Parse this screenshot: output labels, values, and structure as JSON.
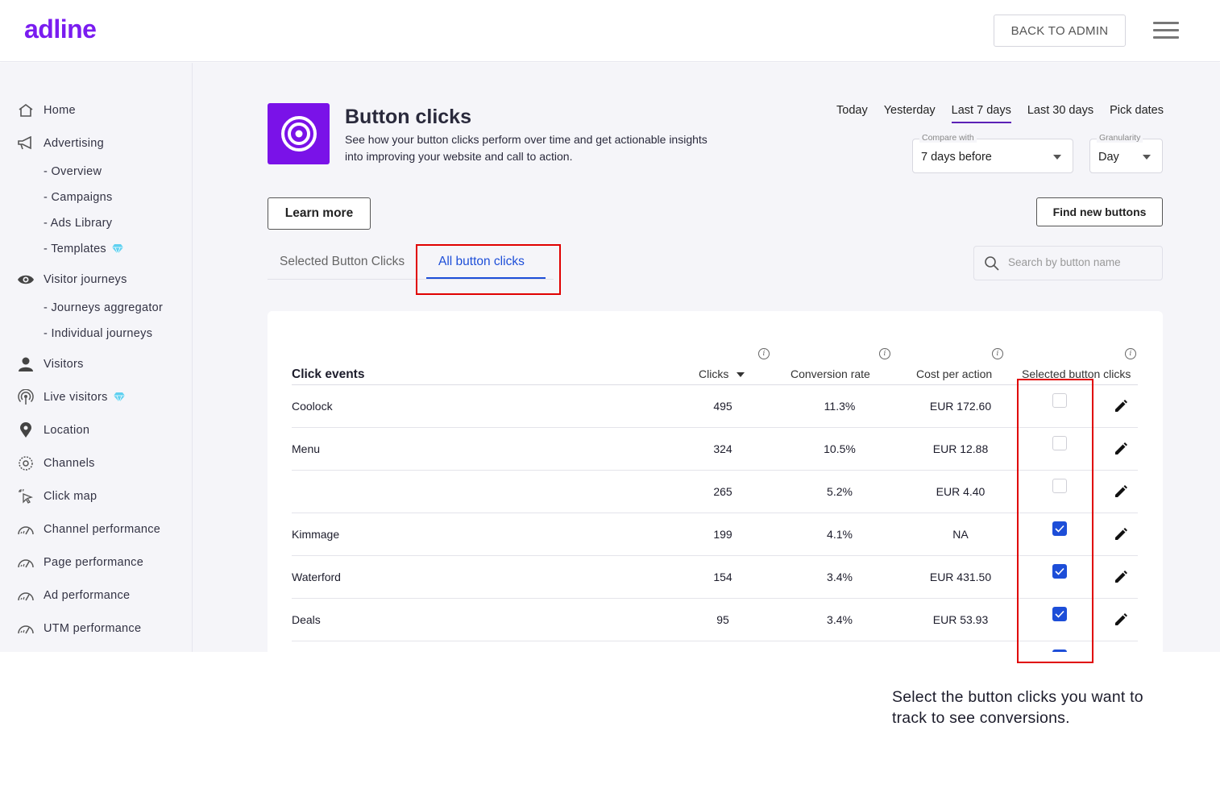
{
  "brand": {
    "logo": "adline",
    "accent": "#7a12e8"
  },
  "topbar": {
    "back_label": "BACK TO ADMIN"
  },
  "sidebar": {
    "items": [
      {
        "label": "Home",
        "icon": "home-icon"
      },
      {
        "label": "Advertising",
        "icon": "megaphone-icon"
      },
      {
        "label": "- Overview",
        "sub": true
      },
      {
        "label": "- Campaigns",
        "sub": true
      },
      {
        "label": "- Ads Library",
        "sub": true
      },
      {
        "label": "- Templates",
        "sub": true,
        "premium": true
      },
      {
        "label": "Visitor journeys",
        "icon": "eye-icon"
      },
      {
        "label": "- Journeys aggregator",
        "sub": true
      },
      {
        "label": "- Individual journeys",
        "sub": true
      },
      {
        "label": "Visitors",
        "icon": "person-icon"
      },
      {
        "label": "Live visitors",
        "icon": "broadcast-icon",
        "premium": true
      },
      {
        "label": "Location",
        "icon": "pin-icon"
      },
      {
        "label": "Channels",
        "icon": "channels-icon"
      },
      {
        "label": "Click map",
        "icon": "cursor-click-icon"
      },
      {
        "label": "Channel performance",
        "icon": "gauge-icon"
      },
      {
        "label": "Page performance",
        "icon": "gauge-icon"
      },
      {
        "label": "Ad performance",
        "icon": "gauge-icon"
      },
      {
        "label": "UTM performance",
        "icon": "gauge-icon"
      }
    ]
  },
  "header": {
    "title": "Button clicks",
    "description": "See how your button clicks perform over time and get actionable insights into improving your website and call to action."
  },
  "date_range": {
    "tabs": [
      "Today",
      "Yesterday",
      "Last 7 days",
      "Last 30 days",
      "Pick dates"
    ],
    "active": "Last 7 days"
  },
  "compare": {
    "label": "Compare with",
    "value": "7 days before"
  },
  "granularity": {
    "label": "Granularity",
    "value": "Day"
  },
  "actions": {
    "learn_more": "Learn more",
    "find_new": "Find new buttons"
  },
  "tabs": {
    "selected": "Selected Button Clicks",
    "all": "All button clicks"
  },
  "search": {
    "placeholder": "Search by button name"
  },
  "table": {
    "headers": {
      "name": "Click events",
      "clicks": "Clicks",
      "conversion": "Conversion rate",
      "cost": "Cost per action",
      "selected": "Selected button clicks"
    },
    "rows": [
      {
        "name": "Coolock",
        "clicks": "495",
        "conversion": "11.3%",
        "cost": "EUR 172.60",
        "selected": false
      },
      {
        "name": "Menu",
        "clicks": "324",
        "conversion": "10.5%",
        "cost": "EUR 12.88",
        "selected": false
      },
      {
        "name": "",
        "clicks": "265",
        "conversion": "5.2%",
        "cost": "EUR 4.40",
        "selected": false
      },
      {
        "name": "Kimmage",
        "clicks": "199",
        "conversion": "4.1%",
        "cost": "NA",
        "selected": true
      },
      {
        "name": "Waterford",
        "clicks": "154",
        "conversion": "3.4%",
        "cost": "EUR 431.50",
        "selected": true
      },
      {
        "name": "Deals",
        "clicks": "95",
        "conversion": "3.4%",
        "cost": "EUR 53.93",
        "selected": true
      }
    ]
  },
  "caption": "Select the button clicks you want to track to see conversions."
}
